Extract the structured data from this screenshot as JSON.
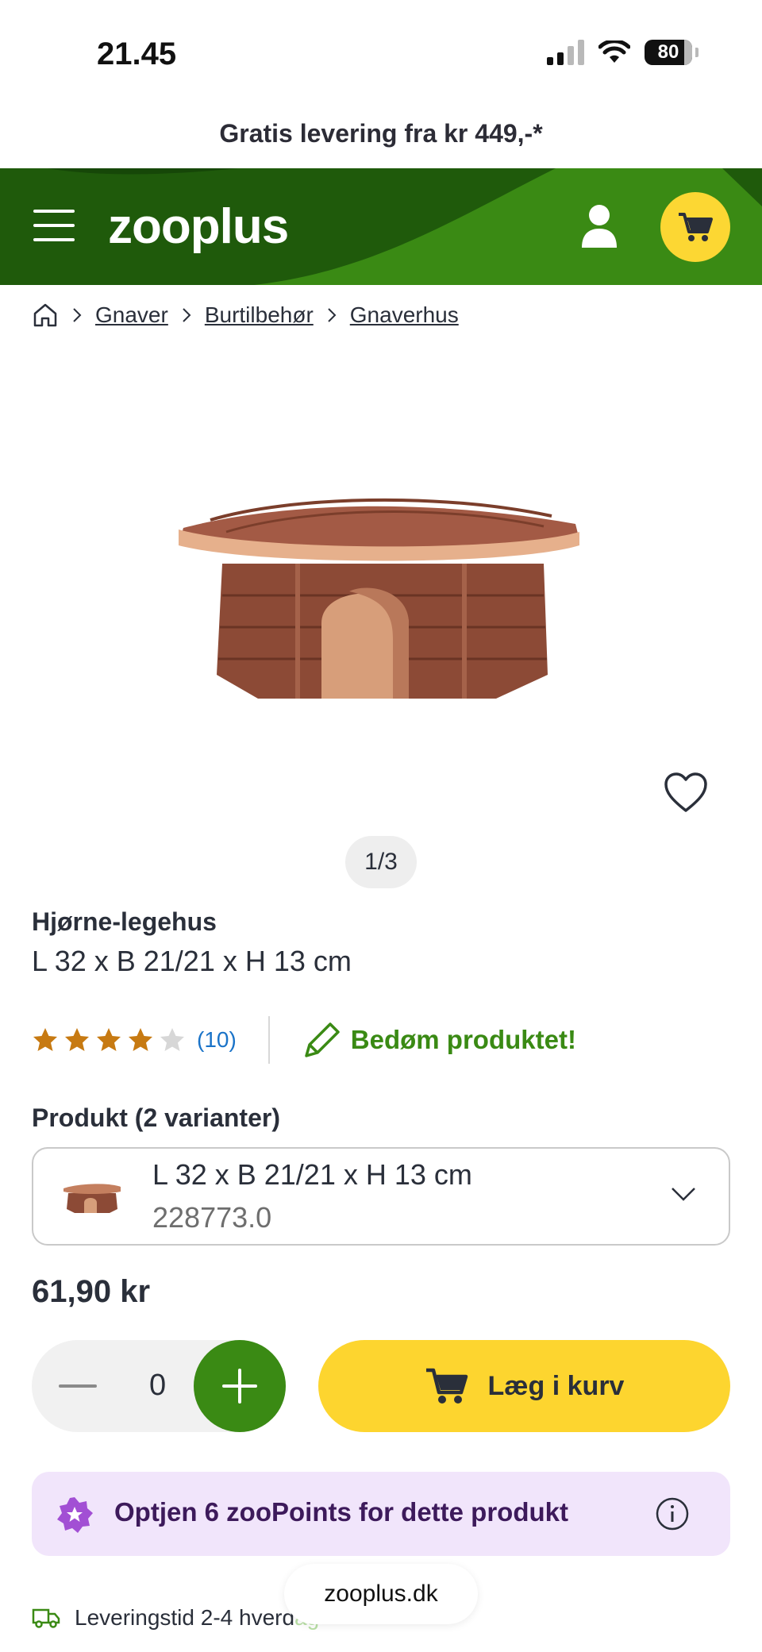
{
  "status_bar": {
    "time": "21.45",
    "battery": "80"
  },
  "promo": {
    "text": "Gratis levering fra kr 449,-*"
  },
  "header": {
    "logo": "zooplus",
    "colors": {
      "green": "#3a8a14",
      "dark_green": "#1f5a0b",
      "cart_yellow": "#fcd733"
    }
  },
  "breadcrumb": {
    "items": [
      "Gnaver",
      "Burtilbehør",
      "Gnaverhus"
    ]
  },
  "gallery": {
    "counter": "1/3"
  },
  "product": {
    "name": "Hjørne-legehus",
    "size": "L 32 x B 21/21 x H 13 cm",
    "rating": 4,
    "rating_max": 5,
    "review_count": "(10)",
    "rate_label": "Bedøm produktet!"
  },
  "variant": {
    "label": "Produkt (2 varianter)",
    "selected_title": "L 32 x B 21/21 x H 13 cm",
    "selected_sku": "228773.0"
  },
  "price": "61,90 kr",
  "quantity": {
    "value": "0"
  },
  "cart_button": {
    "label": "Læg i kurv"
  },
  "zoopoints": {
    "text": "Optjen 6 zooPoints for dette produkt"
  },
  "delivery": {
    "text": "Leveringstid 2-4 hverd",
    "faded_text": "ag"
  },
  "url_pill": {
    "domain": "zooplus.dk"
  },
  "icons": [
    "menu-icon",
    "user-icon",
    "cart-icon",
    "home-icon",
    "chevron-right-icon",
    "heart-icon",
    "star-icon",
    "pencil-icon",
    "chevron-down-icon",
    "truck-icon",
    "zoopoints-icon",
    "info-icon"
  ]
}
